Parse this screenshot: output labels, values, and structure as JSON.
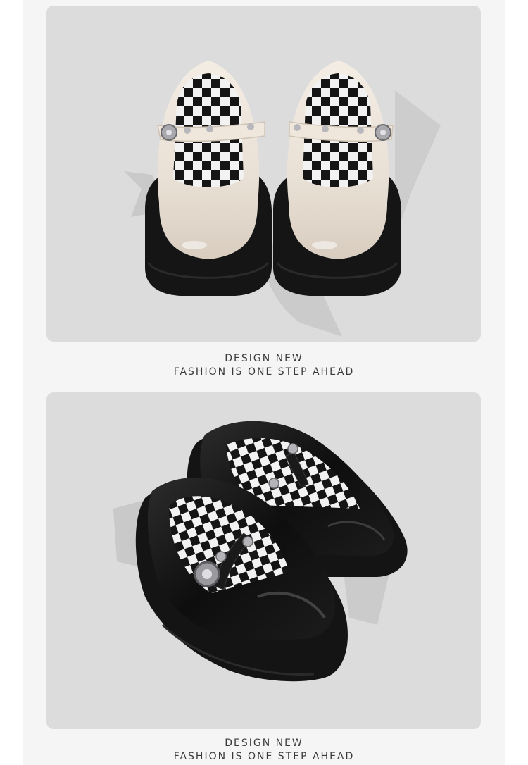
{
  "page": {
    "background": "#ffffff",
    "sheet_color": "#f5f5f6",
    "panel_color": "#dcdcdd"
  },
  "sections": [
    {
      "photo": "cream-patent-mary-jane-platform-shoes",
      "shoe_color": "#ece4da",
      "sole_color": "#161616",
      "insole": "black-white-checkerboard",
      "caption": {
        "line1": "DESIGN NEW",
        "line2": "FASHION IS ONE STEP AHEAD"
      }
    },
    {
      "photo": "black-patent-mary-jane-platform-shoes",
      "shoe_color": "#111111",
      "sole_color": "#161616",
      "insole": "black-white-checkerboard",
      "caption": {
        "line1": "DESIGN NEW",
        "line2": "FASHION IS ONE STEP AHEAD"
      }
    }
  ]
}
